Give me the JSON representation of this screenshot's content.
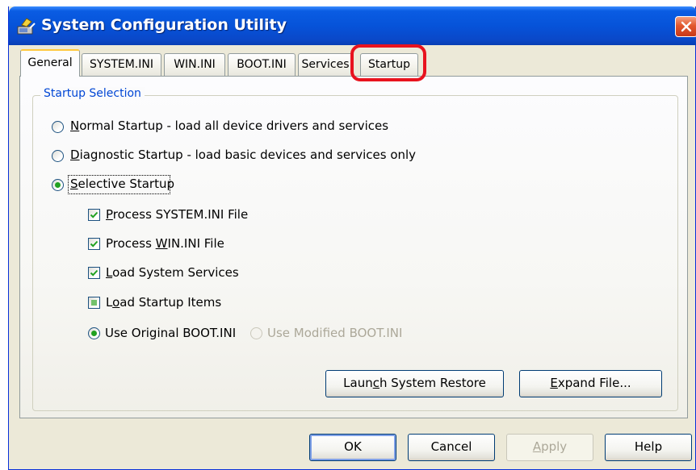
{
  "window": {
    "title": "System Configuration Utility",
    "close_glyph": "✕"
  },
  "tabs": [
    {
      "label": "General",
      "selected": true
    },
    {
      "label": "SYSTEM.INI",
      "selected": false
    },
    {
      "label": "WIN.INI",
      "selected": false
    },
    {
      "label": "BOOT.INI",
      "selected": false
    },
    {
      "label": "Services",
      "selected": false
    },
    {
      "label": "Startup",
      "selected": false,
      "highlighted": true
    }
  ],
  "startup_selection": {
    "group_title": "Startup Selection",
    "options": [
      {
        "accel": "N",
        "rest": "ormal Startup - load all device drivers and services",
        "checked": false
      },
      {
        "accel": "D",
        "rest": "iagnostic Startup - load basic devices and services only",
        "checked": false
      },
      {
        "accel": "S",
        "rest": "elective Startup",
        "checked": true
      }
    ],
    "selective": {
      "items": [
        {
          "pre": "",
          "accel": "P",
          "rest": "rocess SYSTEM.INI File",
          "state": "checked"
        },
        {
          "pre": "Process ",
          "accel": "W",
          "rest": "IN.INI File",
          "state": "checked"
        },
        {
          "pre": "",
          "accel": "L",
          "rest": "oad System Services",
          "state": "checked"
        },
        {
          "pre": "L",
          "accel": "o",
          "rest": "ad Startup Items",
          "state": "indeterminate"
        }
      ],
      "boot_options": [
        {
          "label": "Use Original BOOT.INI",
          "checked": true,
          "enabled": true
        },
        {
          "label": "Use Modified BOOT.INI",
          "checked": false,
          "enabled": false
        }
      ]
    }
  },
  "actions": {
    "launch_restore": {
      "pre": "Laun",
      "accel": "c",
      "rest": "h System Restore"
    },
    "expand_file": {
      "pre": "",
      "accel": "E",
      "rest": "xpand File..."
    }
  },
  "footer": {
    "ok": {
      "label": "OK"
    },
    "cancel": {
      "label": "Cancel"
    },
    "apply": {
      "accel": "A",
      "rest": "pply",
      "enabled": false
    },
    "help": {
      "label": "Help"
    }
  },
  "colors": {
    "titlebar": "#0653d9",
    "highlight_ring": "#e8131e",
    "group_title": "#0046d5",
    "check_green": "#21a121"
  }
}
